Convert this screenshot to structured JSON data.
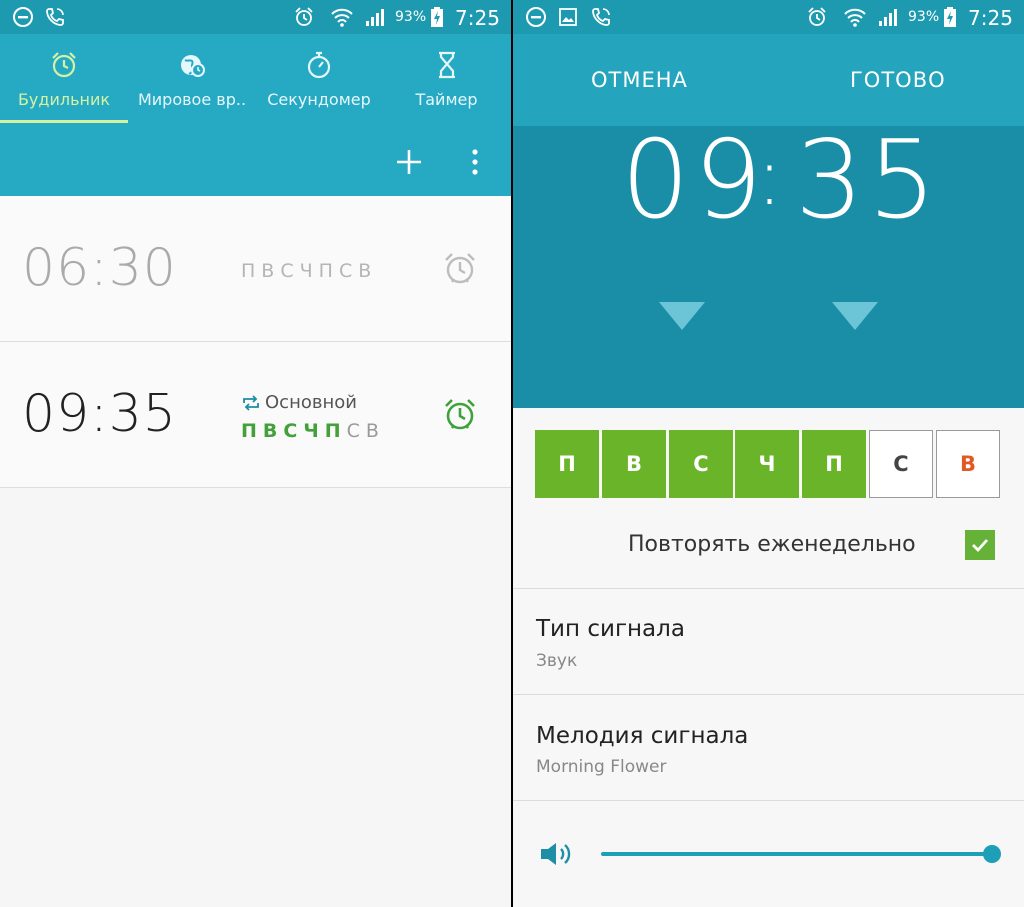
{
  "status_bar": {
    "battery_percent": "93%",
    "time": "7:25"
  },
  "clock_list": {
    "tabs": [
      {
        "label": "Будильник",
        "icon": "alarm-clock-icon",
        "active": true
      },
      {
        "label": "Мировое вр..",
        "icon": "globe-icon",
        "active": false
      },
      {
        "label": "Секундомер",
        "icon": "stopwatch-icon",
        "active": false
      },
      {
        "label": "Таймер",
        "icon": "hourglass-icon",
        "active": false
      }
    ],
    "actions": {
      "add_icon": "plus-icon",
      "menu_icon": "more-vert-icon"
    },
    "alarms": [
      {
        "time": "06:30",
        "name": "",
        "days": [
          "П",
          "В",
          "С",
          "Ч",
          "П",
          "С",
          "В"
        ],
        "active_days": [],
        "enabled": false
      },
      {
        "time": "09:35",
        "name": "Основной",
        "days": [
          "П",
          "В",
          "С",
          "Ч",
          "П",
          "С",
          "В"
        ],
        "active_days": [
          true,
          true,
          true,
          true,
          true,
          false,
          false
        ],
        "enabled": true
      }
    ]
  },
  "alarm_editor": {
    "cancel_label": "ОТМЕНА",
    "done_label": "ГОТОВО",
    "hours": "09",
    "separator": ":",
    "minutes": "35",
    "days": [
      {
        "label": "П",
        "selected": true
      },
      {
        "label": "В",
        "selected": true
      },
      {
        "label": "С",
        "selected": true
      },
      {
        "label": "Ч",
        "selected": true
      },
      {
        "label": "П",
        "selected": true
      },
      {
        "label": "С",
        "selected": false
      },
      {
        "label": "В",
        "selected": false
      }
    ],
    "repeat_label": "Повторять еженедельно",
    "repeat_checked": true,
    "signal_type_title": "Тип сигнала",
    "signal_type_value": "Звук",
    "melody_title": "Мелодия сигнала",
    "melody_value": "Morning Flower",
    "volume_level": 0.98,
    "colors": {
      "accent_green": "#6ab42a",
      "header_teal": "#26aac4",
      "picker_teal": "#1a8ea6",
      "weekend_red": "#e05a26"
    }
  }
}
